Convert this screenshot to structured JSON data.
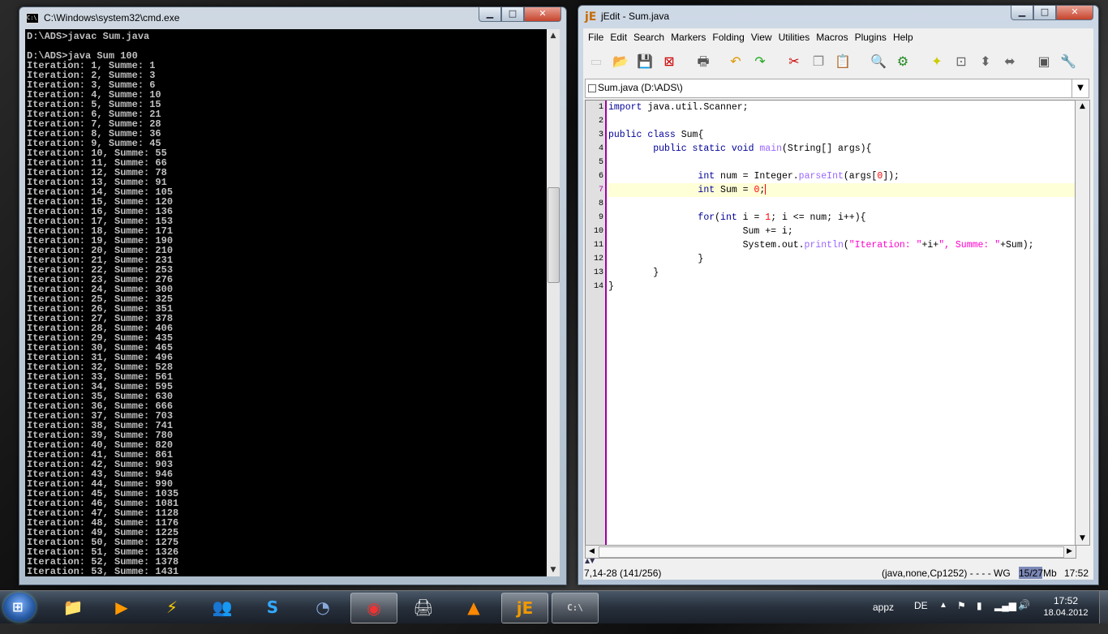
{
  "cmd": {
    "title": "C:\\Windows\\system32\\cmd.exe",
    "icon": "cmd-icon",
    "output": "D:\\ADS>javac Sum.java\n\nD:\\ADS>java Sum 100\nIteration: 1, Summe: 1\nIteration: 2, Summe: 3\nIteration: 3, Summe: 6\nIteration: 4, Summe: 10\nIteration: 5, Summe: 15\nIteration: 6, Summe: 21\nIteration: 7, Summe: 28\nIteration: 8, Summe: 36\nIteration: 9, Summe: 45\nIteration: 10, Summe: 55\nIteration: 11, Summe: 66\nIteration: 12, Summe: 78\nIteration: 13, Summe: 91\nIteration: 14, Summe: 105\nIteration: 15, Summe: 120\nIteration: 16, Summe: 136\nIteration: 17, Summe: 153\nIteration: 18, Summe: 171\nIteration: 19, Summe: 190\nIteration: 20, Summe: 210\nIteration: 21, Summe: 231\nIteration: 22, Summe: 253\nIteration: 23, Summe: 276\nIteration: 24, Summe: 300\nIteration: 25, Summe: 325\nIteration: 26, Summe: 351\nIteration: 27, Summe: 378\nIteration: 28, Summe: 406\nIteration: 29, Summe: 435\nIteration: 30, Summe: 465\nIteration: 31, Summe: 496\nIteration: 32, Summe: 528\nIteration: 33, Summe: 561\nIteration: 34, Summe: 595\nIteration: 35, Summe: 630\nIteration: 36, Summe: 666\nIteration: 37, Summe: 703\nIteration: 38, Summe: 741\nIteration: 39, Summe: 780\nIteration: 40, Summe: 820\nIteration: 41, Summe: 861\nIteration: 42, Summe: 903\nIteration: 43, Summe: 946\nIteration: 44, Summe: 990\nIteration: 45, Summe: 1035\nIteration: 46, Summe: 1081\nIteration: 47, Summe: 1128\nIteration: 48, Summe: 1176\nIteration: 49, Summe: 1225\nIteration: 50, Summe: 1275\nIteration: 51, Summe: 1326\nIteration: 52, Summe: 1378\nIteration: 53, Summe: 1431"
  },
  "window_buttons": {
    "minimize": "▁",
    "maximize": "□",
    "close": "✕"
  },
  "jedit": {
    "title": "jEdit - Sum.java",
    "menu": [
      "File",
      "Edit",
      "Search",
      "Markers",
      "Folding",
      "View",
      "Utilities",
      "Macros",
      "Plugins",
      "Help"
    ],
    "buffer_name": "Sum.java (D:\\ADS\\)",
    "line_numbers": [
      "1",
      "2",
      "3",
      "4",
      "5",
      "6",
      "7",
      "8",
      "9",
      "10",
      "11",
      "12",
      "13",
      "14"
    ],
    "code": {
      "l1a": "import",
      "l1b": " java.util.Scanner;",
      "l3a": "public",
      "l3b": " ",
      "l3c": "class",
      "l3d": " Sum{",
      "l4a": "        ",
      "l4b": "public",
      "l4c": " ",
      "l4d": "static",
      "l4e": " ",
      "l4f": "void",
      "l4g": " ",
      "l4h": "main",
      "l4i": "(String[] args){",
      "l6a": "                ",
      "l6b": "int",
      "l6c": " num = Integer.",
      "l6d": "parseInt",
      "l6e": "(args[",
      "l6f": "0",
      "l6g": "]);",
      "l7a": "                ",
      "l7b": "int",
      "l7c": " Sum = ",
      "l7d": "0",
      "l7e": ";",
      "l9a": "                ",
      "l9b": "for",
      "l9c": "(",
      "l9d": "int",
      "l9e": " i = ",
      "l9f": "1",
      "l9g": "; i <= num; i++){",
      "l10": "                        Sum += i;",
      "l11a": "                        System.out.",
      "l11b": "println",
      "l11c": "(",
      "l11d": "\"Iteration: \"",
      "l11e": "+i+",
      "l11f": "\", Summe: \"",
      "l11g": "+Sum);",
      "l12": "                }",
      "l13": "        }",
      "l14": "}"
    },
    "status": {
      "position": "7,14-28 (141/256)",
      "mode": "(java,none,Cp1252) - - - - WG",
      "memory": "15/27Mb",
      "memory_fraction": 0.55,
      "time": "17:52"
    }
  },
  "taskbar": {
    "start_icon": "windows-start-icon",
    "apps": [
      {
        "name": "explorer-icon",
        "glyph": "📁"
      },
      {
        "name": "media-player-icon",
        "glyph": "▶"
      },
      {
        "name": "winamp-icon",
        "glyph": "⚡"
      },
      {
        "name": "messenger-icon",
        "glyph": "👥"
      },
      {
        "name": "skype-icon",
        "glyph": "S"
      },
      {
        "name": "network-monitor-icon",
        "glyph": "◔"
      },
      {
        "name": "chrome-icon",
        "glyph": "◉"
      },
      {
        "name": "fax-printer-icon",
        "glyph": "🖨"
      },
      {
        "name": "vlc-icon",
        "glyph": "▲"
      },
      {
        "name": "jedit-icon",
        "glyph": "jE"
      },
      {
        "name": "cmd-icon",
        "glyph": "C:\\"
      }
    ],
    "tray": {
      "label": "appz",
      "language": "DE",
      "time": "17:52",
      "date": "18.04.2012"
    }
  }
}
